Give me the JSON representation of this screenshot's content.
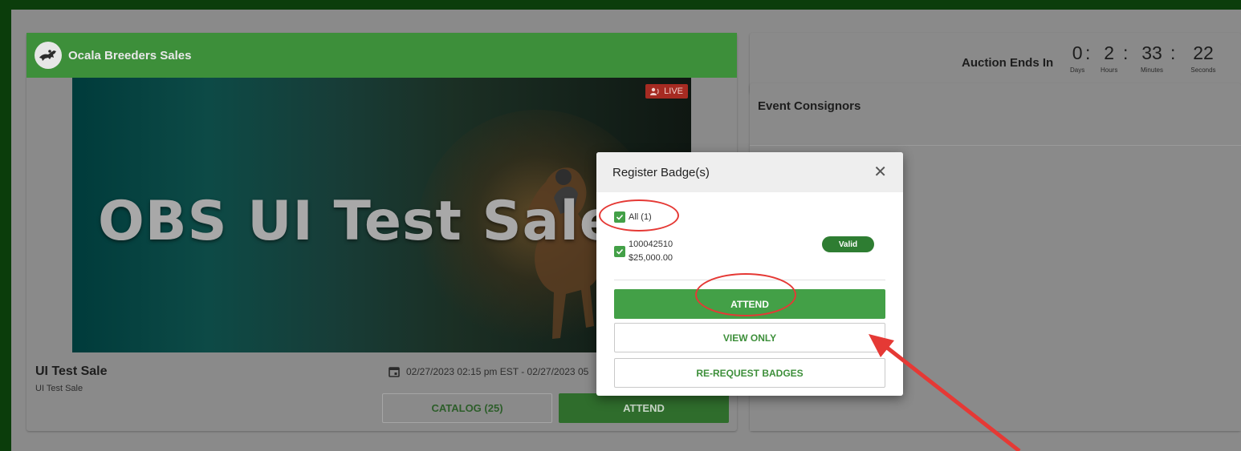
{
  "org": {
    "name": "Ocala Breeders Sales"
  },
  "banner": {
    "title": "OBS UI Test Sale",
    "live_label": "LIVE"
  },
  "sale": {
    "title": "UI Test Sale",
    "subtitle": "UI Test Sale",
    "date_range": "02/27/2023 02:15 pm EST - 02/27/2023 05",
    "catalog_label": "CATALOG (25)",
    "attend_label": "ATTEND"
  },
  "timer": {
    "label": "Auction Ends In",
    "units": [
      {
        "value": "0",
        "caption": "Days"
      },
      {
        "value": "2",
        "caption": "Hours"
      },
      {
        "value": "33",
        "caption": "Minutes"
      },
      {
        "value": "22",
        "caption": "Seconds"
      }
    ]
  },
  "consignors": {
    "title": "Event Consignors"
  },
  "modal": {
    "title": "Register Badge(s)",
    "all_label": "All (1)",
    "badges": [
      {
        "id": "100042510",
        "amount": "$25,000.00",
        "status": "Valid",
        "checked": true
      }
    ],
    "attend_label": "ATTEND",
    "view_only_label": "VIEW ONLY",
    "rerequest_label": "RE-REQUEST BADGES"
  },
  "colors": {
    "page_bg": "#0b3d0b",
    "brand_green": "#3d8f3a",
    "button_green": "#43a047",
    "live_red": "#a62b22",
    "annotation_red": "#e53935"
  },
  "icons": [
    "horse-logo-icon",
    "live-camera-icon",
    "calendar-icon",
    "checkbox-checked-icon",
    "close-icon",
    "annotation-arrow"
  ]
}
